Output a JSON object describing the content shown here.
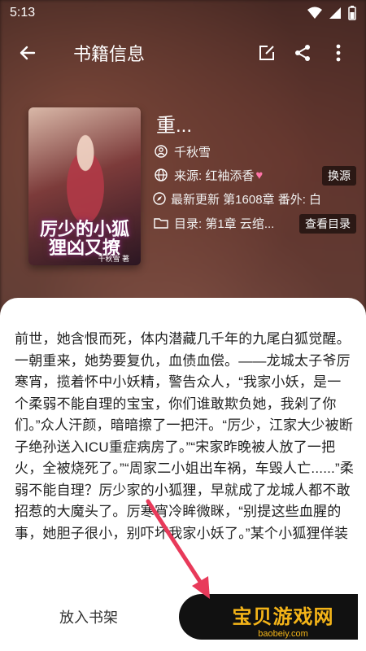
{
  "status": {
    "time": "5:13"
  },
  "app_bar": {
    "title": "书籍信息"
  },
  "book": {
    "cover_title": "厉少的小狐狸凶又撩",
    "cover_tag": "重生甜宠",
    "cover_author": "千秋雪 著",
    "name": "重...",
    "author": "千秋雪",
    "source": "来源: 红袖添香",
    "latest": "最新更新 第1608章 番外: 白...",
    "toc": "目录: 第1章 云绾..."
  },
  "buttons": {
    "change_source": "换源",
    "view_toc": "查看目录",
    "add_shelf": "放入书架"
  },
  "intro": "前世，她含恨而死，体内潜藏几千年的九尾白狐觉醒。一朝重来，她势要复仇，血债血偿。——龙城太子爷厉寒宵，揽着怀中小妖精，警告众人，“我家小妖，是一个柔弱不能自理的宝宝，你们谁敢欺负她，我剁了你们。”众人汗颜，暗暗擦了一把汗。“厉少，江家大少被断子绝孙送入ICU重症病房了。”“宋家昨晚被人放了一把火，全被烧死了。”“周家二小姐出车祸，车毁人亡......”柔弱不能自理？厉少家的小狐狸，早就成了龙城人都不敢招惹的大魔头了。厉寒宵冷眸微眯，“别提这些血腥的事，她胆子很小，别吓坏我家小妖了。”某个小狐狸佯装害怕，瑟瑟发抖缩在厉少怀里，偷偷汲取这世上",
  "watermark": {
    "text": "宝贝游戏网",
    "sub": "baobeiy.com"
  },
  "colors": {
    "accent": "#f4b418",
    "arrow": "#e83a5a",
    "heart": "#ff74a8"
  }
}
